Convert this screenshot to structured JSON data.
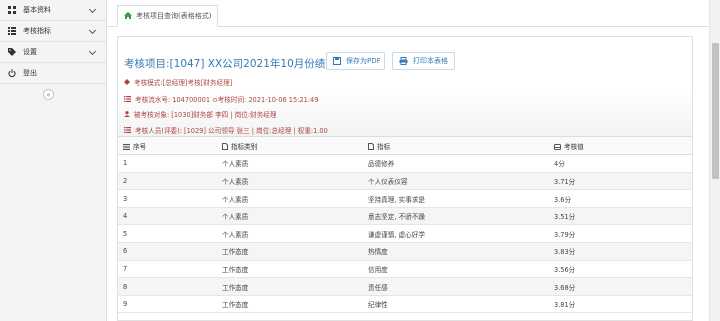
{
  "sidebar": {
    "items": [
      {
        "label": "基本资料",
        "icon": "grid-icon"
      },
      {
        "label": "考核指标",
        "icon": "list-icon"
      },
      {
        "label": "设置",
        "icon": "tag-icon"
      },
      {
        "label": "登出",
        "icon": "power-icon"
      }
    ],
    "collapse_glyph": "«"
  },
  "tabs": [
    {
      "label": "考核项目查询(表格格式)",
      "icon": "home-icon"
    }
  ],
  "panel": {
    "title": "考核项目:[1047] XX公司2021年10月份绩效考核",
    "buttons": {
      "save_pdf": "保存为PDF",
      "print": "打印本表格"
    },
    "info_lines": [
      {
        "icon": "diamond-icon",
        "text": "考核模式:[总经理]考核[财务经理]"
      },
      {
        "icon": "list-icon",
        "text": "考核流水号: 104700001 ⊙考核时间: 2021-10-06 15:21:49"
      },
      {
        "icon": "user-icon",
        "text": "被考核对象: [1030]财务部 李四 | 岗位:财务经理"
      },
      {
        "icon": "list-icon",
        "text": "考核人员(评委): [1029] 公司领导 张三 | 岗位:总经理 | 权重:1.00"
      }
    ],
    "accent_color": "#337ab7",
    "info_color": "#a94442"
  },
  "table": {
    "headers": [
      "序号",
      "指标类别",
      "指标",
      "考核值"
    ],
    "rows": [
      [
        "1",
        "个人素质",
        "品德修养",
        "4分"
      ],
      [
        "2",
        "个人素质",
        "个人仪表仪容",
        "3.71分"
      ],
      [
        "3",
        "个人素质",
        "坚持真理, 实事求是",
        "3.6分"
      ],
      [
        "4",
        "个人素质",
        "意志坚定, 不骄不躁",
        "3.51分"
      ],
      [
        "5",
        "个人素质",
        "谦虚谨慎, 虚心好学",
        "3.79分"
      ],
      [
        "6",
        "工作态度",
        "热情度",
        "3.83分"
      ],
      [
        "7",
        "工作态度",
        "信用度",
        "3.56分"
      ],
      [
        "8",
        "工作态度",
        "责任感",
        "3.68分"
      ],
      [
        "9",
        "工作态度",
        "纪律性",
        "3.81分"
      ]
    ]
  }
}
